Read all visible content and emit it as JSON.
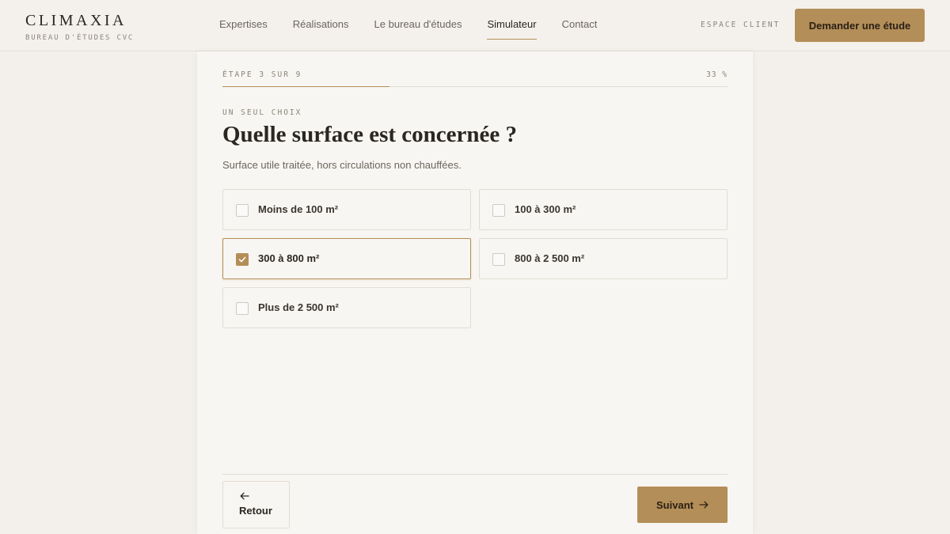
{
  "brand": {
    "name": "CLIMAXIA",
    "subtitle": "BUREAU D'ÉTUDES CVC"
  },
  "nav": {
    "items": [
      {
        "label": "Expertises",
        "active": false
      },
      {
        "label": "Réalisations",
        "active": false
      },
      {
        "label": "Le bureau d'études",
        "active": false
      },
      {
        "label": "Simulateur",
        "active": true
      },
      {
        "label": "Contact",
        "active": false
      }
    ],
    "client_link": "ESPACE CLIENT",
    "cta_label": "Demander une étude"
  },
  "wizard": {
    "step_label": "ÉTAPE 3 SUR 9",
    "percent_label": "33 %",
    "progress": 0.33,
    "kicker": "UN SEUL CHOIX",
    "question": "Quelle surface est concernée ?",
    "hint": "Surface utile traitée, hors circulations non chauffées.",
    "options": [
      {
        "label": "Moins de 100 m²",
        "selected": false
      },
      {
        "label": "100 à 300 m²",
        "selected": false
      },
      {
        "label": "300 à 800 m²",
        "selected": true
      },
      {
        "label": "800 à 2 500 m²",
        "selected": false
      },
      {
        "label": "Plus de 2 500 m²",
        "selected": false
      }
    ],
    "back_label": "Retour",
    "next_label": "Suivant"
  },
  "colors": {
    "accent": "#b48e58",
    "page_bg": "#f3f0eb",
    "card_bg": "#f8f6f2",
    "text": "#2a2622",
    "muted": "#8a847b",
    "border": "#e2ddd5"
  },
  "icons": {
    "check": "check-icon",
    "back": "arrow-left-icon",
    "next": "arrow-right-icon"
  }
}
